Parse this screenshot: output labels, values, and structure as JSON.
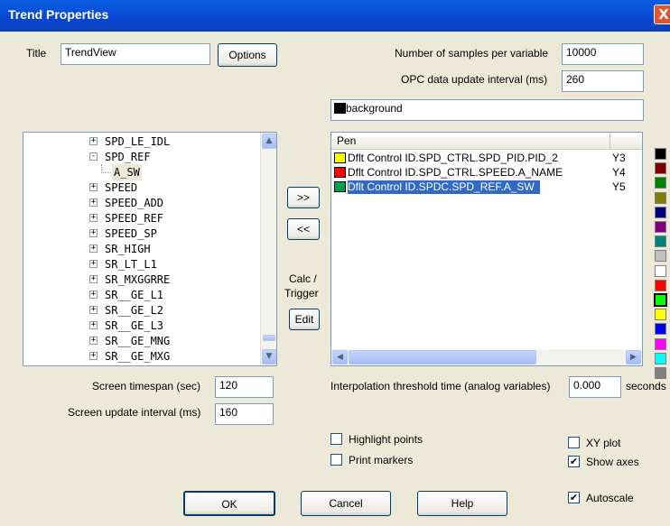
{
  "window": {
    "title": "Trend Properties",
    "close_glyph": "X"
  },
  "title_label": "Title",
  "title_value": "TrendView",
  "options_label": "Options",
  "samples_label": "Number of samples per variable",
  "samples_value": "10000",
  "opc_label": "OPC data update interval (ms)",
  "opc_value": "260",
  "background_label": "background",
  "tree_items": [
    {
      "label": "SPD_LE_IDL",
      "expander": "+"
    },
    {
      "label": "SPD_REF",
      "expander": "-"
    },
    {
      "label": "A_SW",
      "expander": ""
    },
    {
      "label": "SPEED",
      "expander": "+"
    },
    {
      "label": "SPEED_ADD",
      "expander": "+"
    },
    {
      "label": "SPEED_REF",
      "expander": "+"
    },
    {
      "label": "SPEED_SP",
      "expander": "+"
    },
    {
      "label": "SR_HIGH",
      "expander": "+"
    },
    {
      "label": "SR_LT_L1",
      "expander": "+"
    },
    {
      "label": "SR_MXGGRRE",
      "expander": "+"
    },
    {
      "label": "SR__GE_L1",
      "expander": "+"
    },
    {
      "label": "SR__GE_L2",
      "expander": "+"
    },
    {
      "label": "SR__GE_L3",
      "expander": "+"
    },
    {
      "label": "SR__GE_MNG",
      "expander": "+"
    },
    {
      "label": "SR__GE_MXG",
      "expander": "+"
    }
  ],
  "add_btn": ">>",
  "remove_btn": "<<",
  "calc_label": "Calc /",
  "trigger_label": "Trigger",
  "edit_btn": "Edit",
  "pen_header": "Pen",
  "pens": [
    {
      "name": "Dflt Control ID.SPD_CTRL.SPD_PID.PID_2",
      "axis": "Y3",
      "color": "#ffff00"
    },
    {
      "name": "Dflt Control ID.SPD_CTRL.SPEED.A_NAME",
      "axis": "Y4",
      "color": "#ff0000"
    },
    {
      "name": "Dflt Control ID.SPDC.SPD_REF.A_SW",
      "axis": "Y5",
      "color": "#00a050"
    }
  ],
  "palette": [
    "#000000",
    "#800000",
    "#008000",
    "#808000",
    "#000080",
    "#800080",
    "#008080",
    "#c0c0c0",
    "#ffffff",
    "#ff0000",
    "#00ff00",
    "#ffff00",
    "#0000ff",
    "#ff00ff",
    "#00ffff",
    "#808080"
  ],
  "timespan_label": "Screen timespan (sec)",
  "timespan_value": "120",
  "update_label": "Screen update interval (ms)",
  "update_value": "160",
  "interp_label": "Interpolation threshold time (analog variables)",
  "interp_value": "0.000",
  "seconds_label": "seconds",
  "highlight_label": "Highlight points",
  "print_label": "Print markers",
  "xy_label": "XY plot",
  "axes_label": "Show axes",
  "autoscale_label": "Autoscale",
  "check_mark": "✔",
  "ok_btn": "OK",
  "cancel_btn": "Cancel",
  "help_btn": "Help"
}
